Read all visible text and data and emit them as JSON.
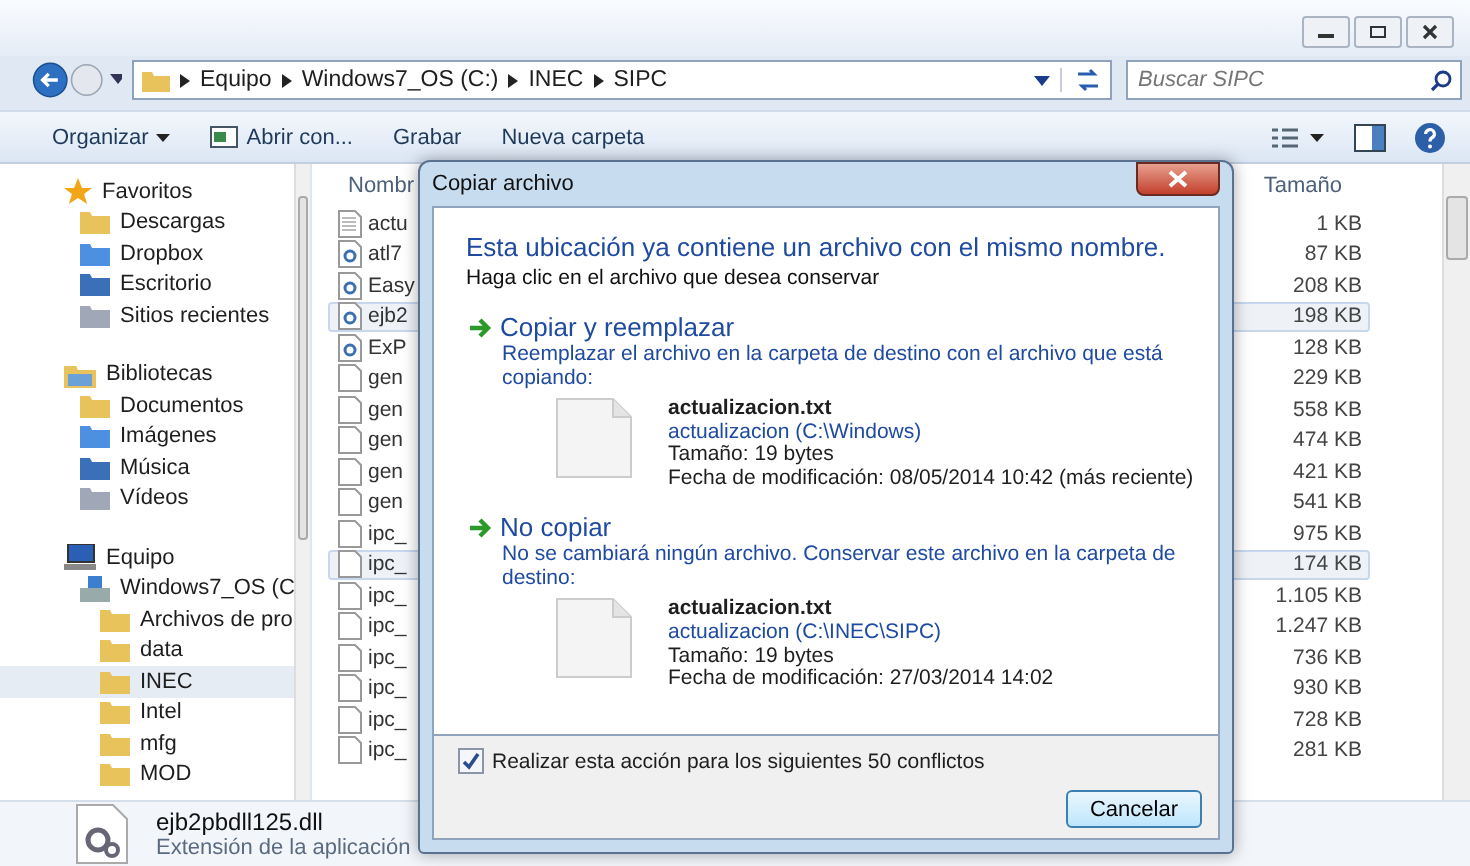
{
  "address_bar": {
    "path": [
      "Equipo",
      "Windows7_OS (C:)",
      "INEC",
      "SIPC"
    ]
  },
  "search": {
    "placeholder": "Buscar SIPC"
  },
  "toolbar": {
    "items": [
      {
        "label": "Organizar",
        "kind": "menu"
      },
      {
        "label": "Abrir con...",
        "kind": "icon"
      },
      {
        "label": "Grabar",
        "kind": "plain"
      },
      {
        "label": "Nueva carpeta",
        "kind": "plain"
      }
    ]
  },
  "sidebar": {
    "items": [
      {
        "label": "Favoritos",
        "selected": false,
        "children": [
          {
            "label": "Descargas",
            "selected": false
          },
          {
            "label": "Dropbox",
            "selected": false
          },
          {
            "label": "Escritorio",
            "selected": false
          },
          {
            "label": "Sitios recientes",
            "selected": false
          }
        ]
      },
      {
        "label": "Bibliotecas",
        "selected": false,
        "children": [
          {
            "label": "Documentos",
            "selected": false
          },
          {
            "label": "Imágenes",
            "selected": false
          },
          {
            "label": "Música",
            "selected": false
          },
          {
            "label": "Vídeos",
            "selected": false
          }
        ]
      },
      {
        "label": "Equipo",
        "selected": false,
        "children": [
          {
            "label": "Windows7_OS (C",
            "selected": false,
            "children": [
              {
                "label": "Archivos de pro",
                "selected": false
              },
              {
                "label": "data",
                "selected": false
              },
              {
                "label": "INEC",
                "selected": true
              },
              {
                "label": "Intel",
                "selected": false
              },
              {
                "label": "mfg",
                "selected": false
              },
              {
                "label": "MOD",
                "selected": false
              }
            ]
          }
        ]
      }
    ]
  },
  "file_list": {
    "columns": [
      "Nombr",
      "Tamaño"
    ],
    "rows": [
      {
        "name": "actu",
        "size": "1 KB",
        "kind": "text",
        "selected": false
      },
      {
        "name": "atl7",
        "size": "87 KB",
        "kind": "dll",
        "selected": false
      },
      {
        "name": "Easy",
        "size": "208 KB",
        "kind": "dll",
        "selected": false
      },
      {
        "name": "ejb2",
        "size": "198 KB",
        "kind": "dll",
        "selected": true
      },
      {
        "name": "ExP",
        "size": "128 KB",
        "kind": "dll",
        "selected": false
      },
      {
        "name": "gen",
        "size": "229 KB",
        "kind": "file",
        "selected": false
      },
      {
        "name": "gen",
        "size": "558 KB",
        "kind": "file",
        "selected": false
      },
      {
        "name": "gen",
        "size": "474 KB",
        "kind": "file",
        "selected": false
      },
      {
        "name": "gen",
        "size": "421 KB",
        "kind": "file",
        "selected": false
      },
      {
        "name": "gen",
        "size": "541 KB",
        "kind": "file",
        "selected": false
      },
      {
        "name": "ipc_",
        "size": "975 KB",
        "kind": "file",
        "selected": false
      },
      {
        "name": "ipc_",
        "size": "174 KB",
        "kind": "file",
        "selected": true
      },
      {
        "name": "ipc_",
        "size": "1.105 KB",
        "kind": "file",
        "selected": false
      },
      {
        "name": "ipc_",
        "size": "1.247 KB",
        "kind": "file",
        "selected": false
      },
      {
        "name": "ipc_",
        "size": "736 KB",
        "kind": "file",
        "selected": false
      },
      {
        "name": "ipc_",
        "size": "930 KB",
        "kind": "file",
        "selected": false
      },
      {
        "name": "ipc_",
        "size": "728 KB",
        "kind": "file",
        "selected": false
      },
      {
        "name": "ipc_",
        "size": "281 KB",
        "kind": "file",
        "selected": false
      }
    ]
  },
  "details": {
    "name": "ejb2pbdll125.dll",
    "type": "Extensión de la aplicación"
  },
  "dialog": {
    "title": "Copiar archivo",
    "heading": "Esta ubicación ya contiene un archivo con el mismo nombre.",
    "subheading": "Haga clic en el archivo que desea conservar",
    "options": [
      {
        "title": "Copiar y reemplazar",
        "description": "Reemplazar el archivo en la carpeta de destino con el archivo que está copiando:",
        "file": {
          "name": "actualizacion.txt",
          "location": "actualizacion (C:\\Windows)",
          "size": "Tamaño: 19 bytes",
          "modified": "Fecha de modificación: 08/05/2014 10:42 (más reciente)"
        }
      },
      {
        "title": "No copiar",
        "description": "No se cambiará ningún archivo. Conservar este archivo en la carpeta de destino:",
        "file": {
          "name": "actualizacion.txt",
          "location": "actualizacion (C:\\INEC\\SIPC)",
          "size": "Tamaño: 19 bytes",
          "modified": "Fecha de modificación: 27/03/2014 14:02"
        }
      }
    ],
    "checkbox": {
      "label": "Realizar esta acción para los siguientes 50 conflictos",
      "checked": true
    },
    "button": "Cancelar"
  }
}
